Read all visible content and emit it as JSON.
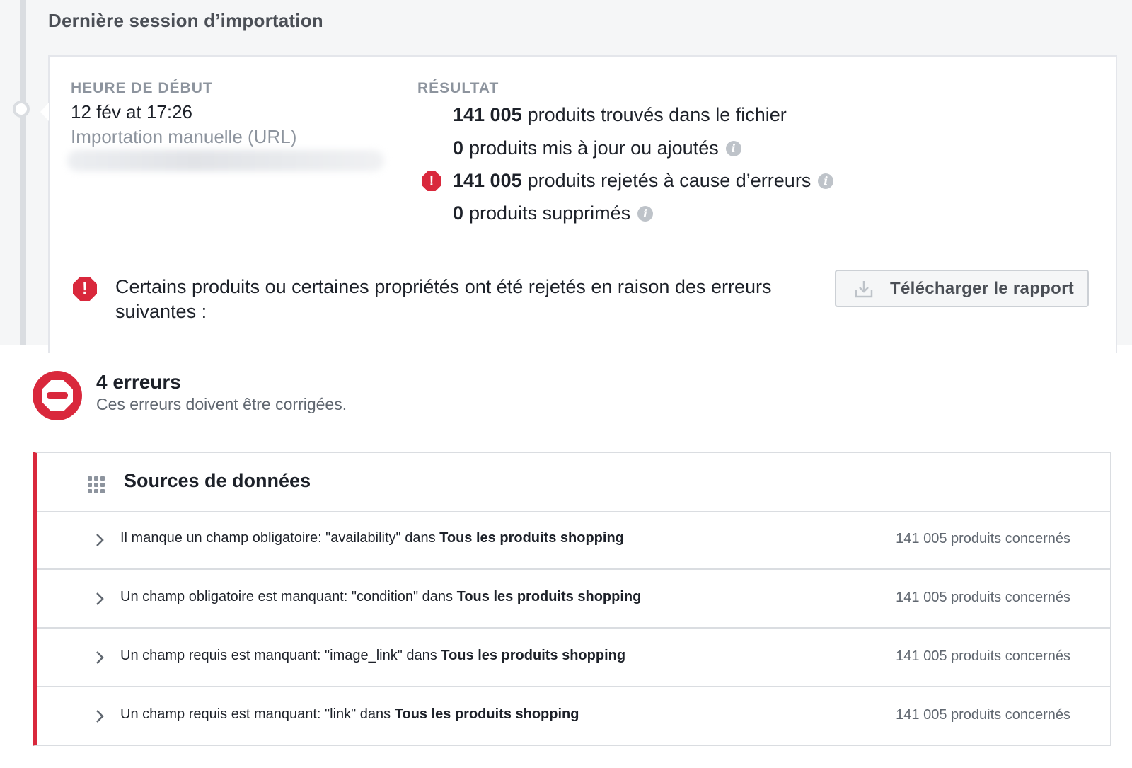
{
  "session": {
    "title": "Dernière session d’importation",
    "start_label": "HEURE DE DÉBUT",
    "start_value": "12 fév at 17:26",
    "start_method": "Importation manuelle (URL)",
    "result_label": "RÉSULTAT",
    "results": [
      {
        "count": "141 005",
        "text": "produits trouvés dans le fichier",
        "info": false,
        "alert": false
      },
      {
        "count": "0",
        "text": "produits mis à jour ou ajoutés",
        "info": true,
        "alert": false
      },
      {
        "count": "141 005",
        "text": "produits rejetés à cause d’erreurs",
        "info": true,
        "alert": true
      },
      {
        "count": "0",
        "text": "produits supprimés",
        "info": true,
        "alert": false
      }
    ],
    "warning_text": "Certains produits ou certaines propriétés ont été rejetés en raison des erreurs suivantes :",
    "download_label": "Télécharger le rapport",
    "icons": {
      "info": "info-icon",
      "alert": "alert-icon",
      "download": "download-icon"
    }
  },
  "errors": {
    "count_label": "4 erreurs",
    "subtitle": "Ces erreurs doivent être corrigées.",
    "accent_color": "#d9283c"
  },
  "table": {
    "title": "Sources de données",
    "rows": [
      {
        "message": "Il manque un champ obligatoire: \"availability\" dans",
        "target": "Tous les produits shopping",
        "affected": "141 005 produits concernés"
      },
      {
        "message": "Un champ obligatoire est manquant: \"condition\" dans",
        "target": "Tous les produits shopping",
        "affected": "141 005 produits concernés"
      },
      {
        "message": "Un champ requis est manquant: \"image_link\" dans",
        "target": "Tous les produits shopping",
        "affected": "141 005 produits concernés"
      },
      {
        "message": "Un champ requis est manquant: \"link\" dans",
        "target": "Tous les produits shopping",
        "affected": "141 005 produits concernés"
      }
    ]
  }
}
